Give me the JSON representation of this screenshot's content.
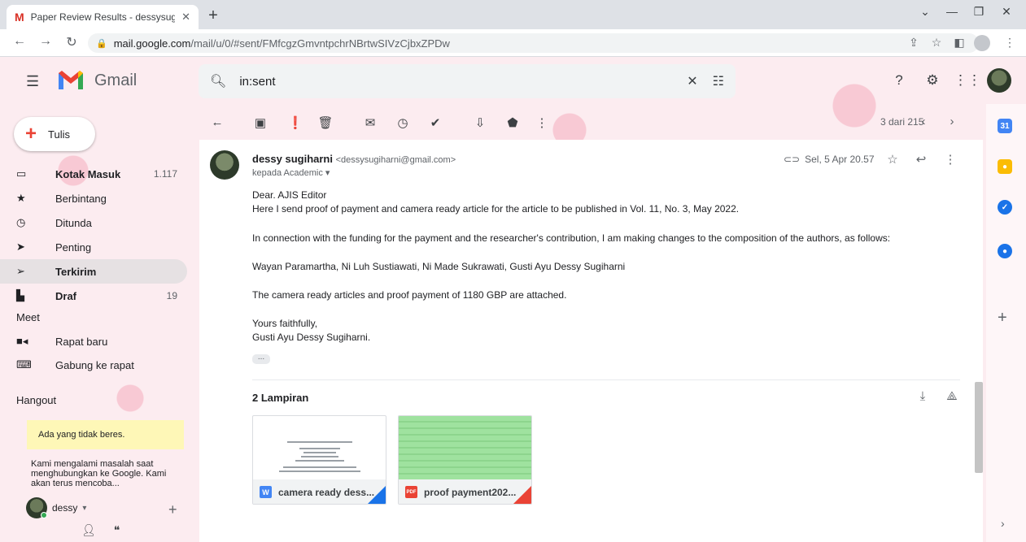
{
  "browser": {
    "tab_title": "Paper Review Results - dessysugi",
    "url_host": "mail.google.com",
    "url_path": "/mail/u/0/#sent/FMfcgzGmvntpchrNBrtwSIVzCjbxZPDw"
  },
  "header": {
    "app_name": "Gmail",
    "search_value": "in:sent"
  },
  "sidebar": {
    "compose_label": "Tulis",
    "items": [
      {
        "label": "Kotak Masuk",
        "count": "1.117",
        "icon": "inbox-icon"
      },
      {
        "label": "Berbintang",
        "count": "",
        "icon": "star-icon"
      },
      {
        "label": "Ditunda",
        "count": "",
        "icon": "clock-icon"
      },
      {
        "label": "Penting",
        "count": "",
        "icon": "important-icon"
      },
      {
        "label": "Terkirim",
        "count": "",
        "icon": "send-icon"
      },
      {
        "label": "Draf",
        "count": "19",
        "icon": "draft-icon"
      }
    ],
    "meet_label": "Meet",
    "meet_items": [
      {
        "label": "Rapat baru",
        "icon": "video-icon"
      },
      {
        "label": "Gabung ke rapat",
        "icon": "keyboard-icon"
      }
    ],
    "hangout_label": "Hangout",
    "hangout_warning": "Ada yang tidak beres.",
    "hangout_message": "Kami mengalami masalah saat menghubungkan ke Google. Kami akan terus mencoba...",
    "hangout_user": "dessy"
  },
  "toolbar": {
    "pager": "3 dari 215"
  },
  "message": {
    "sender_name": "dessy sugiharni",
    "sender_email": "<dessysugiharni@gmail.com>",
    "to_line": "kepada Academic",
    "date": "Sel, 5 Apr 20.57",
    "body": [
      "Dear. AJIS Editor",
      "Here I send proof of payment and  camera ready article for the article to be published in Vol. 11, No. 3, May  2022.",
      "In connection with the funding for the payment and the researcher's contribution, I am making changes to the composition of the authors, as follows:",
      "Wayan Paramartha, Ni Luh Sustiawati, Ni Made Sukrawati, Gusti Ayu Dessy Sugiharni",
      "The camera ready articles and proof payment of 1180 GBP are attached.",
      "Yours faithfully,",
      "Gusti Ayu Dessy Sugiharni."
    ],
    "attachments_title": "2 Lampiran",
    "attachments": [
      {
        "name": "camera ready dess...",
        "badge": "W",
        "badge_color": "#4285f4"
      },
      {
        "name": "proof payment202...",
        "badge": "PDF",
        "badge_color": "#ea4335"
      }
    ]
  },
  "colors": {
    "accent_red": "#ea4335",
    "active_nav_bg": "#e6e1e3",
    "background_theme": "#fcecf0"
  }
}
